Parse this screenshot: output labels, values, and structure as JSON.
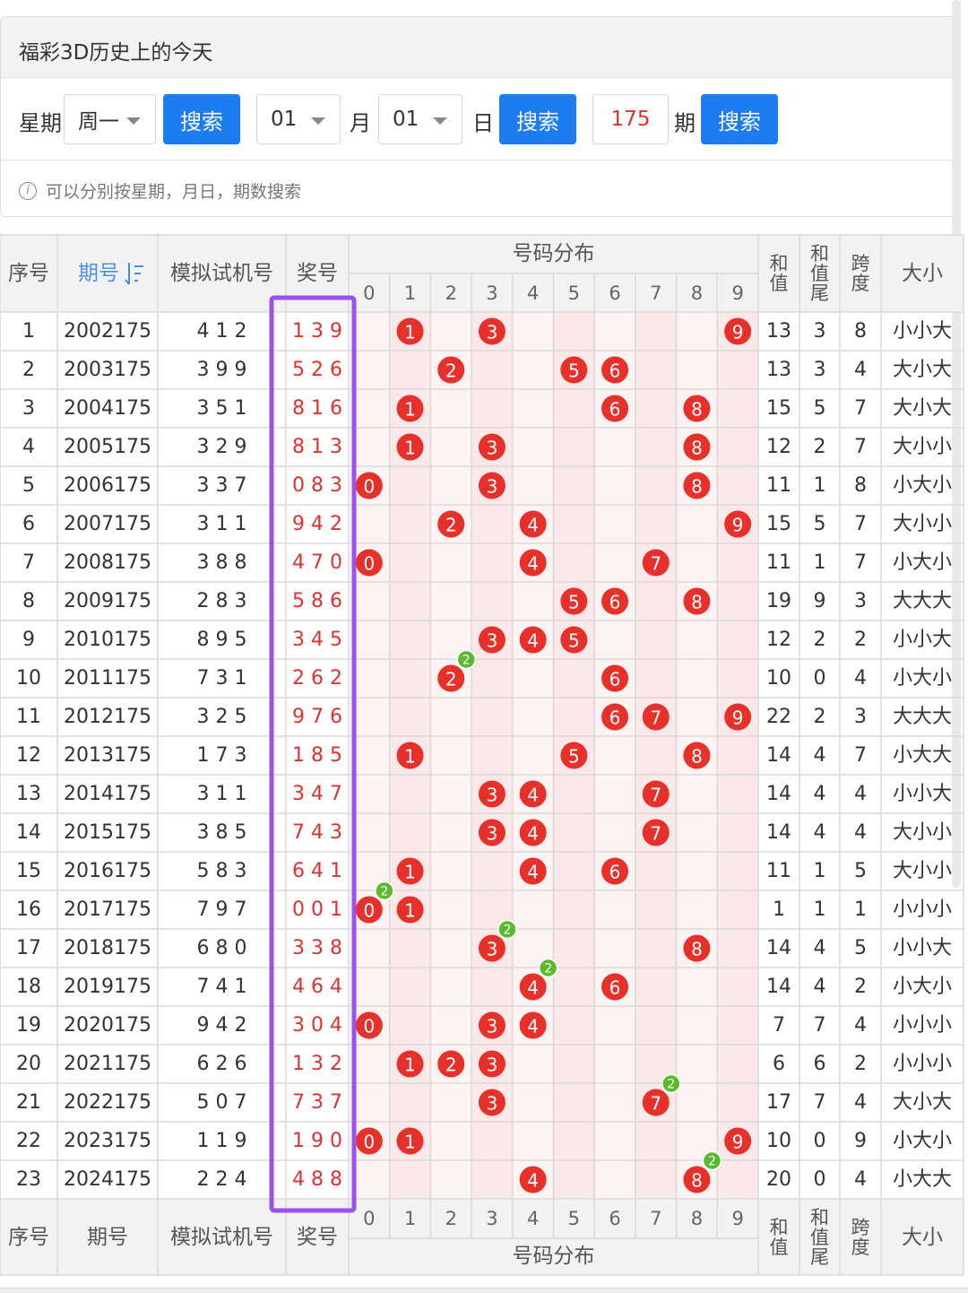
{
  "panel": {
    "title": "福彩3D历史上的今天",
    "hint": "可以分别按星期，月日，期数搜索"
  },
  "search": {
    "week_label": "星期",
    "week_value": "周一",
    "search_label": "搜索",
    "month_value": "01",
    "month_label": "月",
    "day_value": "01",
    "day_label": "日",
    "issue_value": "175",
    "issue_label": "期"
  },
  "table": {
    "headers": {
      "seq": "序号",
      "issue": "期号",
      "sim": "模拟试机号",
      "prize": "奖号",
      "dist": "号码分布",
      "sum": "和值",
      "sum_tail": "和值尾",
      "span": "跨度",
      "size": "大小"
    },
    "digits": [
      "0",
      "1",
      "2",
      "3",
      "4",
      "5",
      "6",
      "7",
      "8",
      "9"
    ],
    "rows": [
      {
        "seq": "1",
        "issue": "2002175",
        "sim": "4 1 2",
        "prize": "1 3 9",
        "sum": "13",
        "tail": "3",
        "span": "8",
        "size": "小小大",
        "nums": [
          1,
          3,
          9
        ],
        "rep": []
      },
      {
        "seq": "2",
        "issue": "2003175",
        "sim": "3 9 9",
        "prize": "5 2 6",
        "sum": "13",
        "tail": "3",
        "span": "4",
        "size": "大小大",
        "nums": [
          2,
          5,
          6
        ],
        "rep": []
      },
      {
        "seq": "3",
        "issue": "2004175",
        "sim": "3 5 1",
        "prize": "8 1 6",
        "sum": "15",
        "tail": "5",
        "span": "7",
        "size": "大小大",
        "nums": [
          1,
          6,
          8
        ],
        "rep": []
      },
      {
        "seq": "4",
        "issue": "2005175",
        "sim": "3 2 9",
        "prize": "8 1 3",
        "sum": "12",
        "tail": "2",
        "span": "7",
        "size": "大小小",
        "nums": [
          1,
          3,
          8
        ],
        "rep": []
      },
      {
        "seq": "5",
        "issue": "2006175",
        "sim": "3 3 7",
        "prize": "0 8 3",
        "sum": "11",
        "tail": "1",
        "span": "8",
        "size": "小大小",
        "nums": [
          0,
          3,
          8
        ],
        "rep": []
      },
      {
        "seq": "6",
        "issue": "2007175",
        "sim": "3 1 1",
        "prize": "9 4 2",
        "sum": "15",
        "tail": "5",
        "span": "7",
        "size": "大小小",
        "nums": [
          2,
          4,
          9
        ],
        "rep": []
      },
      {
        "seq": "7",
        "issue": "2008175",
        "sim": "3 8 8",
        "prize": "4 7 0",
        "sum": "11",
        "tail": "1",
        "span": "7",
        "size": "小大小",
        "nums": [
          0,
          4,
          7
        ],
        "rep": []
      },
      {
        "seq": "8",
        "issue": "2009175",
        "sim": "2 8 3",
        "prize": "5 8 6",
        "sum": "19",
        "tail": "9",
        "span": "3",
        "size": "大大大",
        "nums": [
          5,
          6,
          8
        ],
        "rep": []
      },
      {
        "seq": "9",
        "issue": "2010175",
        "sim": "8 9 5",
        "prize": "3 4 5",
        "sum": "12",
        "tail": "2",
        "span": "2",
        "size": "小小大",
        "nums": [
          3,
          4,
          5
        ],
        "rep": []
      },
      {
        "seq": "10",
        "issue": "2011175",
        "sim": "7 3 1",
        "prize": "2 6 2",
        "sum": "10",
        "tail": "0",
        "span": "4",
        "size": "小大小",
        "nums": [
          2,
          6
        ],
        "rep": [
          2
        ]
      },
      {
        "seq": "11",
        "issue": "2012175",
        "sim": "3 2 5",
        "prize": "9 7 6",
        "sum": "22",
        "tail": "2",
        "span": "3",
        "size": "大大大",
        "nums": [
          6,
          7,
          9
        ],
        "rep": []
      },
      {
        "seq": "12",
        "issue": "2013175",
        "sim": "1 7 3",
        "prize": "1 8 5",
        "sum": "14",
        "tail": "4",
        "span": "7",
        "size": "小大大",
        "nums": [
          1,
          5,
          8
        ],
        "rep": []
      },
      {
        "seq": "13",
        "issue": "2014175",
        "sim": "3 1 1",
        "prize": "3 4 7",
        "sum": "14",
        "tail": "4",
        "span": "4",
        "size": "小小大",
        "nums": [
          3,
          4,
          7
        ],
        "rep": []
      },
      {
        "seq": "14",
        "issue": "2015175",
        "sim": "3 8 5",
        "prize": "7 4 3",
        "sum": "14",
        "tail": "4",
        "span": "4",
        "size": "大小小",
        "nums": [
          3,
          4,
          7
        ],
        "rep": []
      },
      {
        "seq": "15",
        "issue": "2016175",
        "sim": "5 8 3",
        "prize": "6 4 1",
        "sum": "11",
        "tail": "1",
        "span": "5",
        "size": "大小小",
        "nums": [
          1,
          4,
          6
        ],
        "rep": []
      },
      {
        "seq": "16",
        "issue": "2017175",
        "sim": "7 9 7",
        "prize": "0 0 1",
        "sum": "1",
        "tail": "1",
        "span": "1",
        "size": "小小小",
        "nums": [
          0,
          1
        ],
        "rep": [
          0
        ]
      },
      {
        "seq": "17",
        "issue": "2018175",
        "sim": "6 8 0",
        "prize": "3 3 8",
        "sum": "14",
        "tail": "4",
        "span": "5",
        "size": "小小大",
        "nums": [
          3,
          8
        ],
        "rep": [
          3
        ]
      },
      {
        "seq": "18",
        "issue": "2019175",
        "sim": "7 4 1",
        "prize": "4 6 4",
        "sum": "14",
        "tail": "4",
        "span": "2",
        "size": "小大小",
        "nums": [
          4,
          6
        ],
        "rep": [
          4
        ]
      },
      {
        "seq": "19",
        "issue": "2020175",
        "sim": "9 4 2",
        "prize": "3 0 4",
        "sum": "7",
        "tail": "7",
        "span": "4",
        "size": "小小小",
        "nums": [
          0,
          3,
          4
        ],
        "rep": []
      },
      {
        "seq": "20",
        "issue": "2021175",
        "sim": "6 2 6",
        "prize": "1 3 2",
        "sum": "6",
        "tail": "6",
        "span": "2",
        "size": "小小小",
        "nums": [
          1,
          2,
          3
        ],
        "rep": []
      },
      {
        "seq": "21",
        "issue": "2022175",
        "sim": "5 0 7",
        "prize": "7 3 7",
        "sum": "17",
        "tail": "7",
        "span": "4",
        "size": "大小大",
        "nums": [
          3,
          7
        ],
        "rep": [
          7
        ]
      },
      {
        "seq": "22",
        "issue": "2023175",
        "sim": "1 1 9",
        "prize": "1 9 0",
        "sum": "10",
        "tail": "0",
        "span": "9",
        "size": "小大小",
        "nums": [
          0,
          1,
          9
        ],
        "rep": []
      },
      {
        "seq": "23",
        "issue": "2024175",
        "sim": "2 2 4",
        "prize": "4 8 8",
        "sum": "20",
        "tail": "0",
        "span": "4",
        "size": "小大大",
        "nums": [
          4,
          8
        ],
        "rep": [
          8
        ]
      }
    ],
    "repeat_badge": "2",
    "sort_icon": "sort-icon"
  },
  "colors": {
    "accent": "#1c7cf2",
    "ball": "#e8302a",
    "badge": "#5cb82e",
    "highlight_border": "#9b51f0",
    "prize_text": "#e03030",
    "header_bg": "#f2f2f2"
  }
}
